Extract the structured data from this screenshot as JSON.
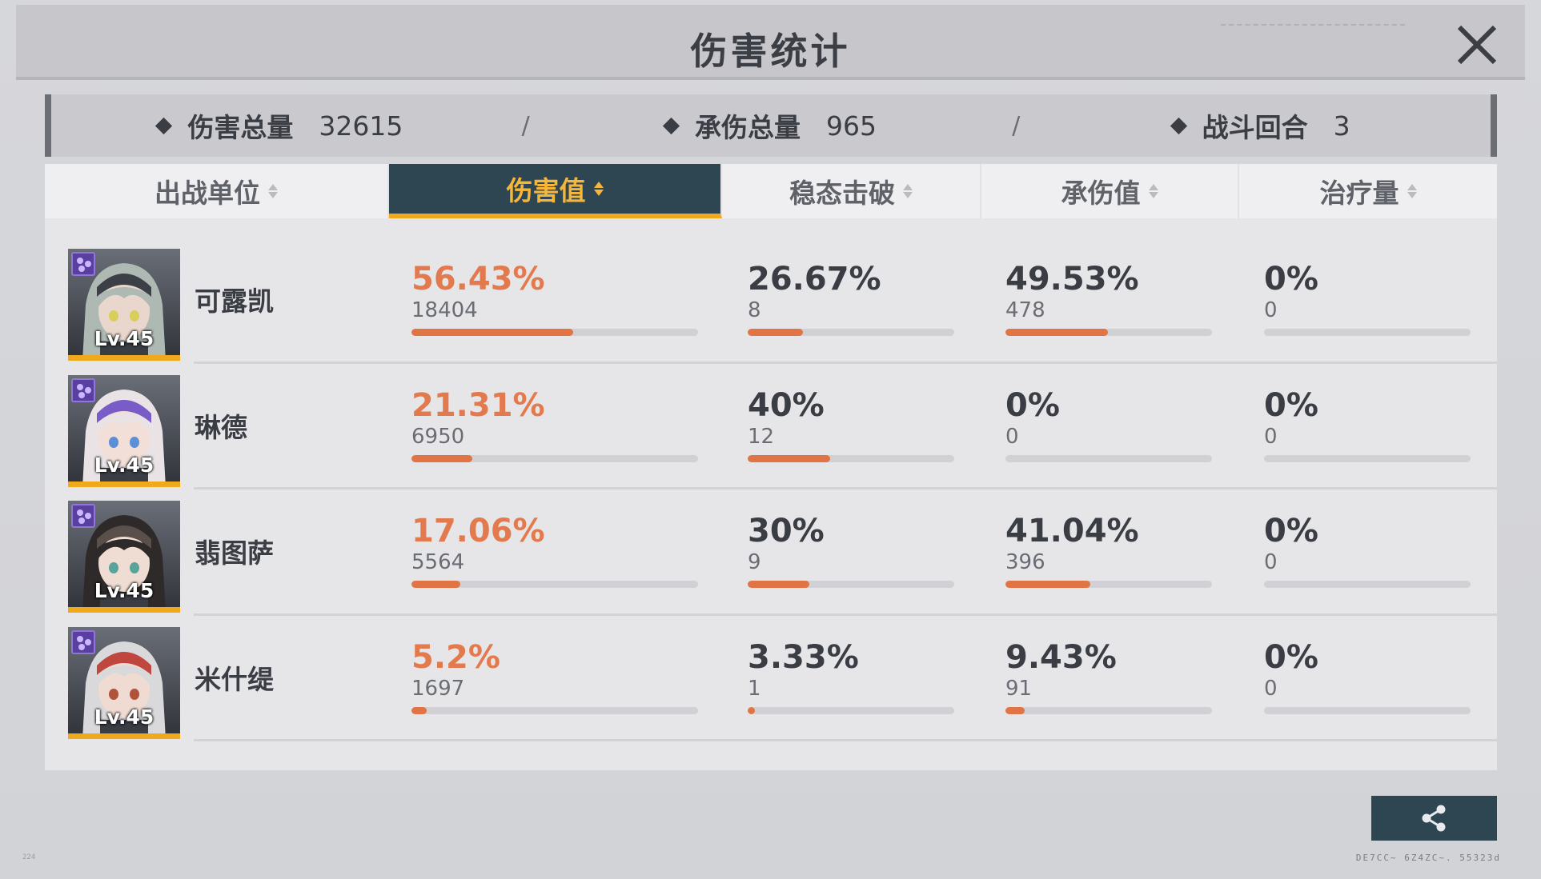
{
  "window": {
    "title": "伤害统计"
  },
  "summary": {
    "items": [
      {
        "label": "伤害总量",
        "value": "32615"
      },
      {
        "label": "承伤总量",
        "value": "965"
      },
      {
        "label": "战斗回合",
        "value": "3"
      }
    ],
    "separator": "/"
  },
  "columns": [
    {
      "label": "出战单位",
      "active": false
    },
    {
      "label": "伤害值",
      "active": true
    },
    {
      "label": "稳态击破",
      "active": false
    },
    {
      "label": "承伤值",
      "active": false
    },
    {
      "label": "治疗量",
      "active": false
    }
  ],
  "units": [
    {
      "name": "可露凯",
      "level": "Lv.45",
      "damage": {
        "pct": "56.43%",
        "raw": "18404",
        "fill": 0.5643
      },
      "break": {
        "pct": "26.67%",
        "raw": "8",
        "fill": 0.2667
      },
      "taken": {
        "pct": "49.53%",
        "raw": "478",
        "fill": 0.4953
      },
      "heal": {
        "pct": "0%",
        "raw": "0",
        "fill": 0
      }
    },
    {
      "name": "琳德",
      "level": "Lv.45",
      "damage": {
        "pct": "21.31%",
        "raw": "6950",
        "fill": 0.2131
      },
      "break": {
        "pct": "40%",
        "raw": "12",
        "fill": 0.4
      },
      "taken": {
        "pct": "0%",
        "raw": "0",
        "fill": 0
      },
      "heal": {
        "pct": "0%",
        "raw": "0",
        "fill": 0
      }
    },
    {
      "name": "翡图萨",
      "level": "Lv.45",
      "damage": {
        "pct": "17.06%",
        "raw": "5564",
        "fill": 0.1706
      },
      "break": {
        "pct": "30%",
        "raw": "9",
        "fill": 0.3
      },
      "taken": {
        "pct": "41.04%",
        "raw": "396",
        "fill": 0.4104
      },
      "heal": {
        "pct": "0%",
        "raw": "0",
        "fill": 0
      }
    },
    {
      "name": "米什缇",
      "level": "Lv.45",
      "damage": {
        "pct": "5.2%",
        "raw": "1697",
        "fill": 0.052
      },
      "break": {
        "pct": "3.33%",
        "raw": "1",
        "fill": 0.0333
      },
      "taken": {
        "pct": "9.43%",
        "raw": "91",
        "fill": 0.0943
      },
      "heal": {
        "pct": "0%",
        "raw": "0",
        "fill": 0
      }
    }
  ],
  "avatars": [
    {
      "hair": "#aeb9b3",
      "accent": "#3c3f45",
      "skin": "#e9d6cc",
      "eye": "#d8cf5a"
    },
    {
      "hair": "#e9e3e6",
      "accent": "#7a5cc8",
      "skin": "#f1dfd8",
      "eye": "#5c8fd6"
    },
    {
      "hair": "#2f2a2a",
      "accent": "#5a4f4a",
      "skin": "#efdcd2",
      "eye": "#5aa39a"
    },
    {
      "hair": "#d9d9dc",
      "accent": "#c0473f",
      "skin": "#efdbd1",
      "eye": "#b0533a"
    }
  ],
  "icons": {
    "close": "close-icon",
    "share": "share-icon",
    "sort": "sort-icon",
    "diamond": "diamond-icon",
    "element_badge": "element-badge-icon"
  },
  "colors": {
    "accent_orange": "#e37a4d",
    "active_tab_bg": "#2e4552",
    "active_tab_text": "#f5b63a",
    "level_border": "#f0a81c"
  },
  "footer": {
    "code": "DE7CC~ 6Z4ZC~. 55323d",
    "corner": "224"
  }
}
